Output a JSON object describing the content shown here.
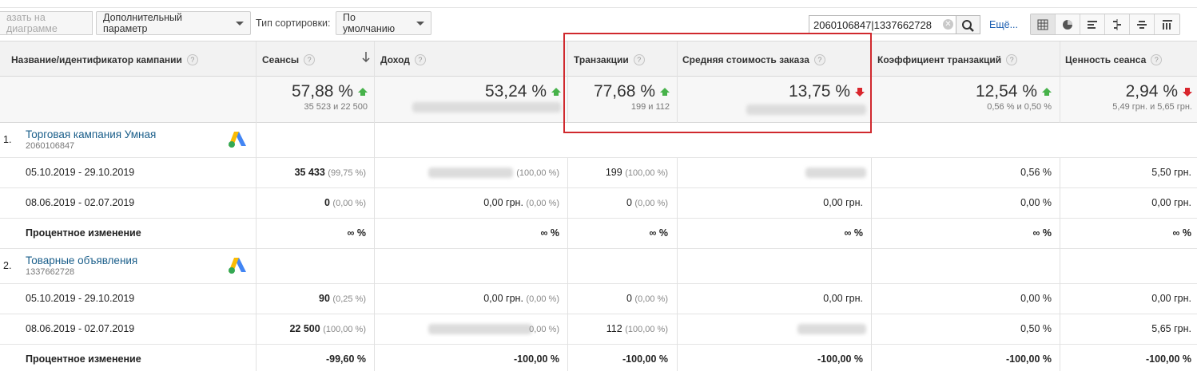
{
  "toolbar": {
    "plot_label": "азать на диаграмме",
    "secondary_dimension_label": "Дополнительный параметр",
    "sort_type_label": "Тип сортировки:",
    "sort_value": "По умолчанию",
    "search_value": "2060106847|1337662728",
    "more_label": "Ещё...",
    "views": [
      "table-view-icon",
      "pie-view-icon",
      "performance-view-icon",
      "comparison-view-icon",
      "term-cloud-icon",
      "pivot-view-icon"
    ]
  },
  "headers": {
    "campaign": "Название/идентификатор кампании",
    "sessions": "Сеансы",
    "revenue": "Доход",
    "transactions": "Транзакции",
    "avg_order": "Средняя стоимость заказа",
    "conv_rate": "Коэффициент транзакций",
    "session_value": "Ценность сеанса"
  },
  "summary": {
    "sessions": {
      "pct": "57,88 %",
      "sub": "35 523 и 22 500"
    },
    "revenue": {
      "pct": "53,24 %"
    },
    "transactions": {
      "pct": "77,68 %",
      "sub": "199 и 112"
    },
    "avg_order": {
      "pct": "13,75 %"
    },
    "conv_rate": {
      "pct": "12,54 %",
      "sub": "0,56 % и 0,50 %"
    },
    "session_value": {
      "pct": "2,94 %",
      "sub": "5,49 грн. и 5,65 грн."
    }
  },
  "campaigns": [
    {
      "num": "1.",
      "name": "Торговая кампания Умная",
      "id": "2060106847",
      "rows": [
        {
          "label": "05.10.2019 - 29.10.2019",
          "sessions": "35 433",
          "sessions_pct": "(99,75 %)",
          "revenue": "",
          "revenue_pct": "(100,00 %)",
          "transactions": "199",
          "transactions_pct": "(100,00 %)",
          "avg_order": "",
          "conv_rate": "0,56 %",
          "session_value": "5,50 грн."
        },
        {
          "label": "08.06.2019 - 02.07.2019",
          "sessions": "0",
          "sessions_pct": "(0,00 %)",
          "revenue": "0,00 грн.",
          "revenue_pct": "(0,00 %)",
          "transactions": "0",
          "transactions_pct": "(0,00 %)",
          "avg_order": "0,00 грн.",
          "conv_rate": "0,00 %",
          "session_value": "0,00 грн."
        }
      ],
      "change": {
        "label": "Процентное изменение",
        "sessions": "∞ %",
        "revenue": "∞ %",
        "transactions": "∞ %",
        "avg_order": "∞ %",
        "conv_rate": "∞ %",
        "session_value": "∞ %"
      }
    },
    {
      "num": "2.",
      "name": "Товарные объявления",
      "id": "1337662728",
      "rows": [
        {
          "label": "05.10.2019 - 29.10.2019",
          "sessions": "90",
          "sessions_pct": "(0,25 %)",
          "revenue": "0,00 грн.",
          "revenue_pct": "(0,00 %)",
          "transactions": "0",
          "transactions_pct": "(0,00 %)",
          "avg_order": "0,00 грн.",
          "conv_rate": "0,00 %",
          "session_value": "0,00 грн."
        },
        {
          "label": "08.06.2019 - 02.07.2019",
          "sessions": "22 500",
          "sessions_pct": "(100,00 %)",
          "revenue": "",
          "revenue_pct": "0,00 %)",
          "transactions": "112",
          "transactions_pct": "(100,00 %)",
          "avg_order": "",
          "conv_rate": "0,50 %",
          "session_value": "5,65 грн."
        }
      ],
      "change": {
        "label": "Процентное изменение",
        "sessions": "-99,60 %",
        "revenue": "-100,00 %",
        "transactions": "-100,00 %",
        "avg_order": "-100,00 %",
        "conv_rate": "-100,00 %",
        "session_value": "-100,00 %"
      }
    }
  ],
  "colors": {
    "accent_link": "#1a5e8a",
    "up": "#47b24a",
    "down": "#d9262d",
    "highlight": "#d0292e"
  }
}
